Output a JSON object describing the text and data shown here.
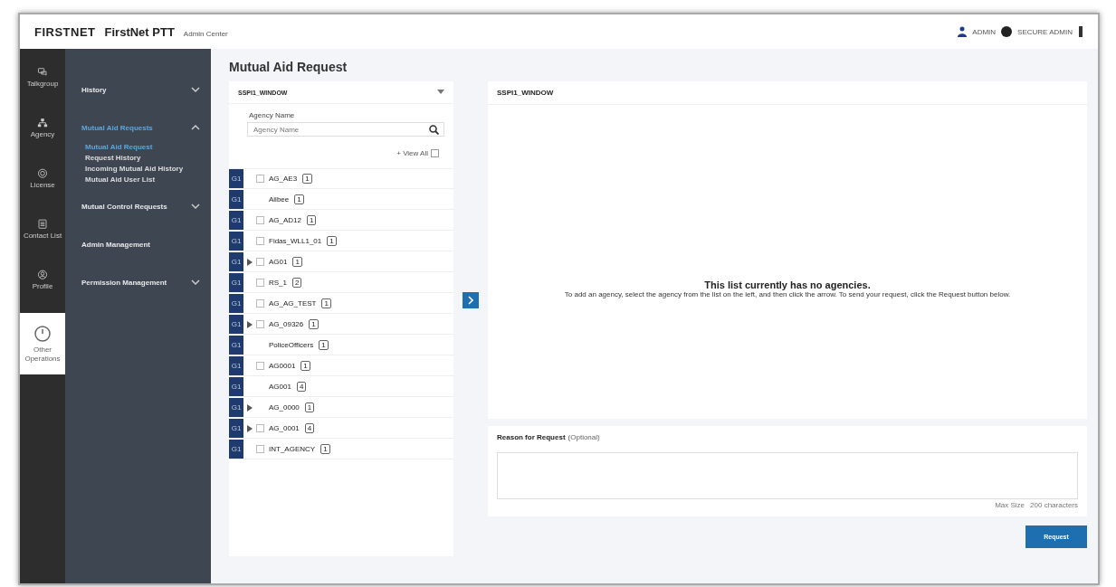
{
  "header": {
    "brand": "FIRSTNET",
    "product": "FirstNet PTT",
    "subtitle": "Admin Center",
    "user": "ADMIN",
    "role": "SECURE ADMIN"
  },
  "rail": [
    {
      "label": "Talkgroup",
      "selected": false
    },
    {
      "label": "Agency",
      "selected": false
    },
    {
      "label": "License",
      "selected": false
    },
    {
      "label": "Contact List",
      "selected": false
    },
    {
      "label": "Profile",
      "selected": false
    },
    {
      "label": "Other Operations",
      "selected": true
    }
  ],
  "nav": [
    {
      "label": "History",
      "expanded": false,
      "selected": false
    },
    {
      "label": "Mutual Aid Requests",
      "expanded": true,
      "selected": true,
      "children": [
        {
          "label": "Mutual Aid Request",
          "selected": true
        },
        {
          "label": "Request History",
          "selected": false
        },
        {
          "label": "Incoming Mutual Aid History",
          "selected": false
        },
        {
          "label": "Mutual Aid User List",
          "selected": false
        }
      ]
    },
    {
      "label": "Mutual Control Requests",
      "expanded": false,
      "selected": false
    },
    {
      "label": "Admin Management",
      "selected": false
    },
    {
      "label": "Permission Management",
      "expanded": false,
      "selected": false
    }
  ],
  "page_title": "Mutual Aid Request",
  "source": {
    "dropdown": "SSPI1_WINDOW",
    "field_label": "Agency Name",
    "placeholder": "Agency Name",
    "view_all": "+ View All",
    "rows": [
      {
        "tag": "G1",
        "name": "AG_AE3",
        "count": "1",
        "kind": "agency",
        "expandable": false,
        "checked": false
      },
      {
        "tag": "G1",
        "name": "Ailbee",
        "count": "1",
        "kind": "member",
        "expandable": false
      },
      {
        "tag": "G1",
        "name": "AG_AD12",
        "count": "1",
        "kind": "agency",
        "expandable": false,
        "checked": false
      },
      {
        "tag": "G1",
        "name": "Fidas_WLL1_01",
        "count": "1",
        "kind": "agency",
        "expandable": false,
        "checked": false
      },
      {
        "tag": "G1",
        "name": "AG01",
        "count": "1",
        "kind": "agency",
        "expandable": true,
        "checked": false
      },
      {
        "tag": "G1",
        "name": "RS_1",
        "count": "2",
        "kind": "agency",
        "expandable": false,
        "checked": false
      },
      {
        "tag": "G1",
        "name": "AG_AG_TEST",
        "count": "1",
        "kind": "agency",
        "expandable": false,
        "checked": false
      },
      {
        "tag": "G1",
        "name": "AG_09326",
        "count": "1",
        "kind": "agency",
        "expandable": true,
        "checked": false
      },
      {
        "tag": "G1",
        "name": "PoliceOfficers",
        "count": "1",
        "kind": "member",
        "expandable": false
      },
      {
        "tag": "G1",
        "name": "AG0001",
        "count": "1",
        "kind": "agency",
        "expandable": false,
        "checked": false
      },
      {
        "tag": "G1",
        "name": "AG001",
        "count": "4",
        "kind": "member",
        "expandable": false
      },
      {
        "tag": "G1",
        "name": "AG_0000",
        "count": "1",
        "kind": "member",
        "expandable": true
      },
      {
        "tag": "G1",
        "name": "AG_0001",
        "count": "4",
        "kind": "agency",
        "expandable": true,
        "checked": false
      },
      {
        "tag": "G1",
        "name": "INT_AGENCY",
        "count": "1",
        "kind": "agency",
        "expandable": false,
        "checked": false
      }
    ]
  },
  "target": {
    "title": "SSPI1_WINDOW",
    "empty_title": "This list currently has no agencies.",
    "empty_text": "To add an agency, select the agency from the list on the left, and then click the arrow. To send your request, click the Request button below."
  },
  "reason": {
    "label": "Reason for Request",
    "optional": "(Optional)",
    "max_size": "Max Size",
    "limit": "200 characters"
  },
  "request_button": "Request"
}
